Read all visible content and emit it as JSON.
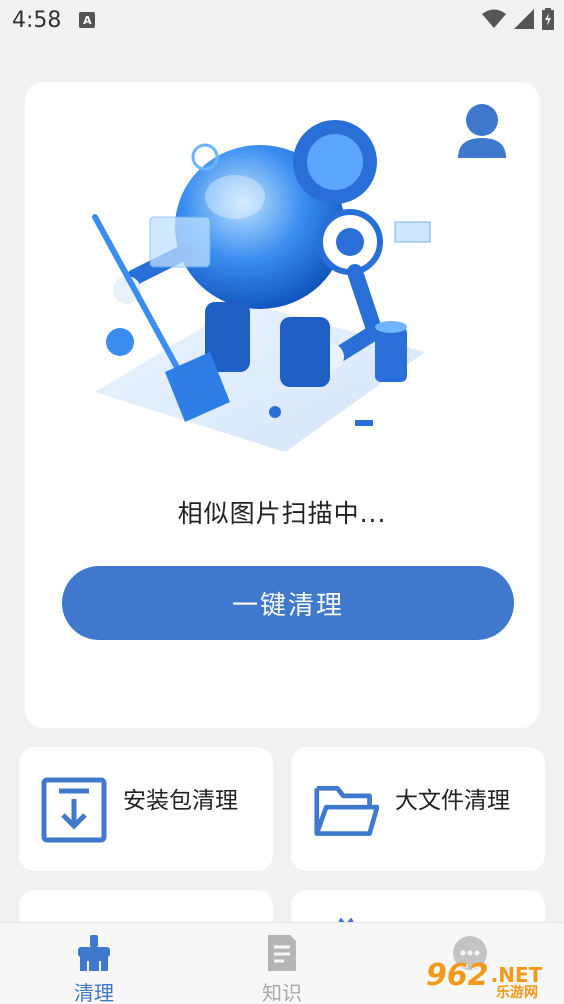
{
  "status_bar": {
    "time": "4:58",
    "notification_icon": "A"
  },
  "main": {
    "scan_text": "相似图片扫描中...",
    "clean_button_label": "一键清理"
  },
  "features": [
    {
      "label": "安装包清理",
      "icon": "download-box-icon"
    },
    {
      "label": "大文件清理",
      "icon": "folder-icon"
    }
  ],
  "nav": {
    "items": [
      {
        "label": "清理",
        "icon": "broom-icon",
        "active": true
      },
      {
        "label": "知识",
        "icon": "document-icon",
        "active": false
      },
      {
        "label": "",
        "icon": "chat-icon",
        "active": false
      }
    ]
  },
  "watermark": {
    "number": "962",
    "suffix": ".NET",
    "sub": "乐游网"
  },
  "colors": {
    "accent": "#3f78cc",
    "background": "#f2f2f2",
    "card": "#ffffff"
  }
}
